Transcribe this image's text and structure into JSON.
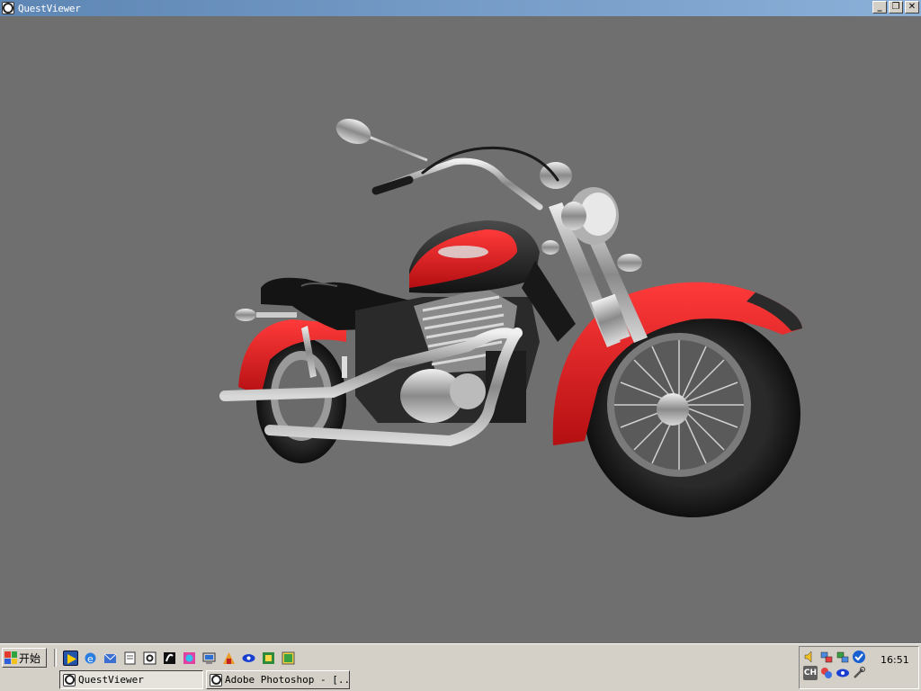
{
  "window": {
    "title": "QuestViewer",
    "buttons": {
      "minimize": "_",
      "restore": "❐",
      "close": "✕"
    }
  },
  "viewport": {
    "background": "#6f6f6f",
    "subject": "motorcycle-3d-model"
  },
  "taskbar": {
    "start_label": "开始",
    "quick_launch": [
      "media-player-icon",
      "internet-explorer-icon",
      "outlook-icon",
      "notepad-icon",
      "app-icon",
      "app-icon",
      "app-icon",
      "my-computer-icon",
      "app-icon",
      "eye-icon",
      "app-icon",
      "app-icon"
    ],
    "tasks": [
      {
        "label": "QuestViewer",
        "active": true
      },
      {
        "label": "Adobe Photoshop - [...",
        "active": false
      }
    ],
    "tray": {
      "clock": "16:51",
      "ime_label": "CH",
      "icons": [
        "volume-icon",
        "network-icon",
        "network-icon",
        "check-icon",
        "ime-icon",
        "app-icon",
        "eye-icon",
        "tool-icon"
      ]
    }
  }
}
